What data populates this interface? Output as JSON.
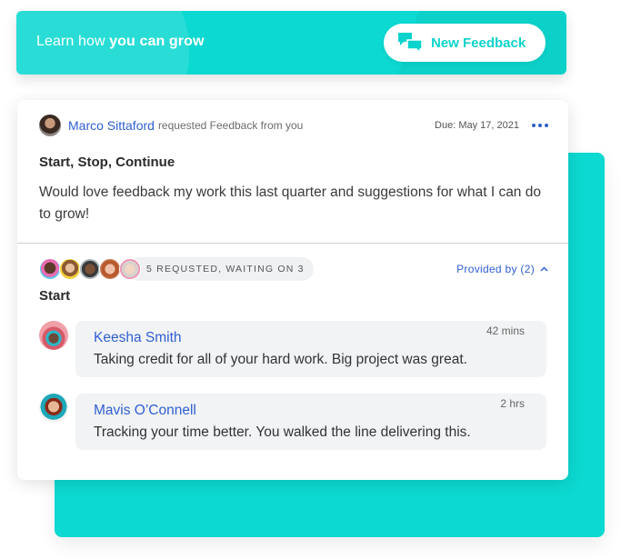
{
  "banner": {
    "text_prefix": "Learn how ",
    "text_bold": "you can grow",
    "button_label": "New Feedback",
    "button_icon": "chat-bubbles-icon"
  },
  "request": {
    "requester_name": "Marco Sittaford",
    "action_text": "requested Feedback from you",
    "due": "Due: May 17, 2021",
    "more_icon": "more-horizontal-icon",
    "title": "Start, Stop, Continue",
    "body": "Would love feedback my work this last quarter and suggestions for what I can do to grow!"
  },
  "requested": {
    "avatars": [
      "requested-avatar-1",
      "requested-avatar-2",
      "requested-avatar-3",
      "requested-avatar-4",
      "requested-avatar-5"
    ],
    "status": "5 REQUSTED, WAITING ON 3",
    "provided_by": "Provided by (2)",
    "toggle_icon": "chevron-up-icon"
  },
  "section": {
    "label": "Start"
  },
  "comments": [
    {
      "author": "Keesha Smith",
      "time": "42 mins",
      "text": "Taking credit for all of your hard work.  Big project was great."
    },
    {
      "author": "Mavis O’Connell",
      "time": "2 hrs",
      "text": "Tracking your time better.  You walked the line delivering this."
    }
  ],
  "colors": {
    "accent_teal": "#0cd9d1",
    "link_blue": "#2f5fd0",
    "bubble_bg": "#f2f3f5"
  }
}
